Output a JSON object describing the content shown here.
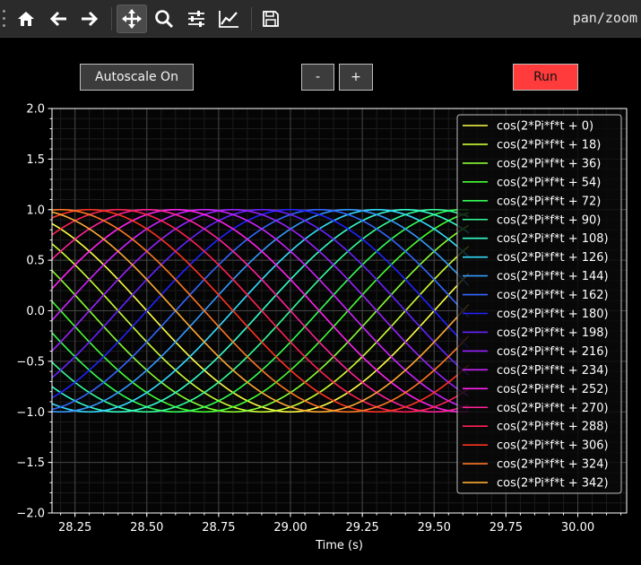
{
  "toolbar": {
    "mode_label": "pan/zoom",
    "icons": [
      "home-icon",
      "back-arrow-icon",
      "forward-arrow-icon",
      "pan-move-icon",
      "zoom-magnifier-icon",
      "subplots-sliders-icon",
      "edit-axes-curve-icon",
      "save-floppy-icon"
    ]
  },
  "controls": {
    "autoscale_label": "Autoscale On",
    "minus_label": "-",
    "plus_label": "+",
    "run_label": "Run"
  },
  "colors": {
    "run_button": "#ff3b3b",
    "background": "#000000",
    "toolbar": "#2b2b2b"
  },
  "chart_data": {
    "type": "line",
    "xlabel": "Time (s)",
    "ylabel": "",
    "xlim": [
      28.17,
      30.17
    ],
    "ylim": [
      -2.0,
      2.0
    ],
    "xticks": [
      "28.25",
      "28.50",
      "28.75",
      "29.00",
      "29.25",
      "29.50",
      "29.75",
      "30.00"
    ],
    "xtick_values": [
      28.25,
      28.5,
      28.75,
      29.0,
      29.25,
      29.5,
      29.75,
      30.0
    ],
    "yticks": [
      "2.0",
      "1.5",
      "1.0",
      "0.5",
      "0.0",
      "−0.5",
      "−1.0",
      "−1.5",
      "−2.0"
    ],
    "ytick_values": [
      2.0,
      1.5,
      1.0,
      0.5,
      0.0,
      -0.5,
      -1.0,
      -1.5,
      -2.0
    ],
    "grid": true,
    "legend_position": "upper-right",
    "frequency_hz": 0.5,
    "data_x_range": [
      28.17,
      29.62
    ],
    "series": [
      {
        "name": "cos(2*Pi*f*t + 0)",
        "phase_deg": 0,
        "color": "#ffff44"
      },
      {
        "name": "cos(2*Pi*f*t + 18)",
        "phase_deg": 18,
        "color": "#ccff33"
      },
      {
        "name": "cos(2*Pi*f*t + 36)",
        "phase_deg": 36,
        "color": "#88ff33"
      },
      {
        "name": "cos(2*Pi*f*t + 54)",
        "phase_deg": 54,
        "color": "#44ff33"
      },
      {
        "name": "cos(2*Pi*f*t + 72)",
        "phase_deg": 72,
        "color": "#33ff55"
      },
      {
        "name": "cos(2*Pi*f*t + 90)",
        "phase_deg": 90,
        "color": "#33ff99"
      },
      {
        "name": "cos(2*Pi*f*t + 108)",
        "phase_deg": 108,
        "color": "#33ffcc"
      },
      {
        "name": "cos(2*Pi*f*t + 126)",
        "phase_deg": 126,
        "color": "#33ddff"
      },
      {
        "name": "cos(2*Pi*f*t + 144)",
        "phase_deg": 144,
        "color": "#3399ff"
      },
      {
        "name": "cos(2*Pi*f*t + 162)",
        "phase_deg": 162,
        "color": "#3366ff"
      },
      {
        "name": "cos(2*Pi*f*t + 180)",
        "phase_deg": 180,
        "color": "#2222ff"
      },
      {
        "name": "cos(2*Pi*f*t + 198)",
        "phase_deg": 198,
        "color": "#6622ff"
      },
      {
        "name": "cos(2*Pi*f*t + 216)",
        "phase_deg": 216,
        "color": "#9922ff"
      },
      {
        "name": "cos(2*Pi*f*t + 234)",
        "phase_deg": 234,
        "color": "#cc22ff"
      },
      {
        "name": "cos(2*Pi*f*t + 252)",
        "phase_deg": 252,
        "color": "#ff22ee"
      },
      {
        "name": "cos(2*Pi*f*t + 270)",
        "phase_deg": 270,
        "color": "#ff2299"
      },
      {
        "name": "cos(2*Pi*f*t + 288)",
        "phase_deg": 288,
        "color": "#ff2255"
      },
      {
        "name": "cos(2*Pi*f*t + 306)",
        "phase_deg": 306,
        "color": "#ff3322"
      },
      {
        "name": "cos(2*Pi*f*t + 324)",
        "phase_deg": 324,
        "color": "#ff7722"
      },
      {
        "name": "cos(2*Pi*f*t + 342)",
        "phase_deg": 342,
        "color": "#ffaa33"
      }
    ]
  }
}
